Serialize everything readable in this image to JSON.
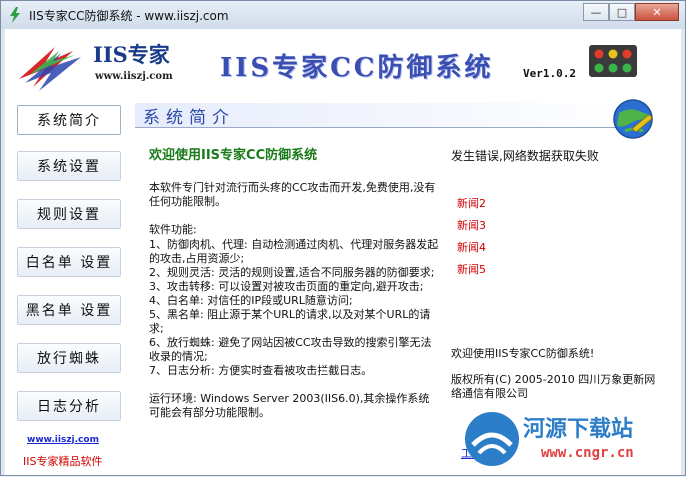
{
  "window": {
    "title": "IIS专家CC防御系统 - www.iiszj.com",
    "controls": {
      "minimize": "—",
      "maximize": "□",
      "close": "✕"
    }
  },
  "header": {
    "logo_text": "IIS专家",
    "logo_url": "www.iiszj.com",
    "app_title": "IIS专家CC防御系统",
    "version": "Ver1.0.2"
  },
  "sidebar": {
    "items": [
      {
        "label": "系统简介",
        "active": true
      },
      {
        "label": "系统设置",
        "active": false
      },
      {
        "label": "规则设置",
        "active": false
      },
      {
        "label": "白名单 设置",
        "active": false
      },
      {
        "label": "黑名单 设置",
        "active": false
      },
      {
        "label": "放行蜘蛛",
        "active": false
      },
      {
        "label": "日志分析",
        "active": false
      }
    ],
    "url_link": "www.iiszj.com",
    "footer": "IIS专家精品软件"
  },
  "content": {
    "section_title": "系统简介",
    "welcome": "欢迎使用IIS专家CC防御系统",
    "intro": " 本软件专门针对流行而头疼的CC攻击而开发,免费使用,没有任何功能限制。",
    "features_title": "软件功能:",
    "features": [
      " 1、防御肉机、代理: 自动检测通过肉机、代理对服务器发起的攻击,占用资源少;",
      " 2、规则灵活: 灵活的规则设置,适合不同服务器的防御要求;",
      " 3、攻击转移: 可以设置对被攻击页面的重定向,避开攻击;",
      " 4、白名单: 对信任的IP段或URL随意访问;",
      " 5、黑名单: 阻止源于某个URL的请求,以及对某个URL的请求;",
      " 6、放行蜘蛛: 避免了网站因被CC攻击导致的搜索引擎无法收录的情况;",
      " 7、日志分析: 方便实时查看被攻击拦截日志。"
    ],
    "env": "运行环境: Windows Server 2003(IIS6.0),其余操作系统可能会有部分功能限制。"
  },
  "right_panel": {
    "error": "发生错误,网络数据获取失败",
    "news": [
      "新闻2",
      "新闻3",
      "新闻4",
      "新闻5"
    ],
    "welcome": "欢迎使用IIS专家CC防御系统!",
    "copyright": "版权所有(C) 2005-2010 四川万象更新网络通信有限公司",
    "link": "工作室"
  },
  "watermark": {
    "text": "河源下载站",
    "url": "www.cngr.cn"
  },
  "colors": {
    "title_blue": "#3b4fb3",
    "welcome_green": "#1a7a1a",
    "news_red": "#d00000",
    "link_blue": "#1a2ad0"
  }
}
